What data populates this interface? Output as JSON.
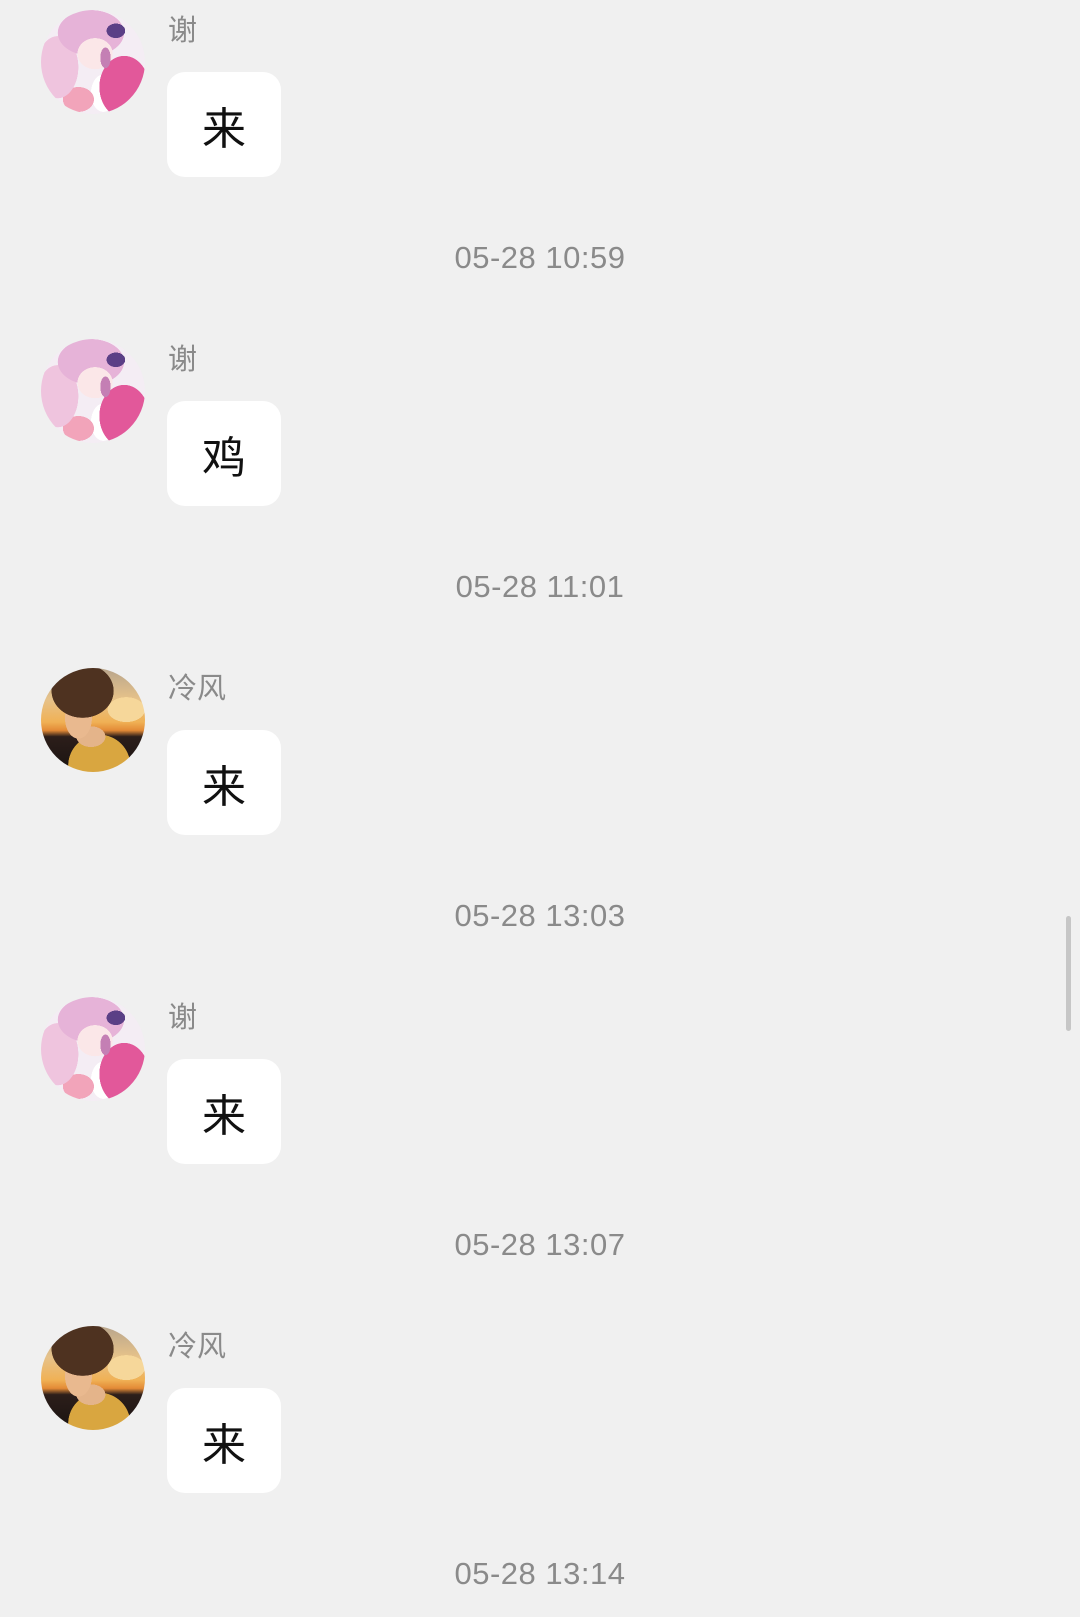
{
  "theme": {
    "background": "#f0f0f0",
    "bubble": "#ffffff",
    "meta_text": "#8a8a8a"
  },
  "timeline": [
    {
      "type": "message",
      "sender": "谢",
      "avatar_icon": "anime-girl-avatar",
      "text": "来"
    },
    {
      "type": "time",
      "text": "05-28 10:59"
    },
    {
      "type": "message",
      "sender": "谢",
      "avatar_icon": "anime-girl-avatar",
      "text": "鸡"
    },
    {
      "type": "time",
      "text": "05-28 11:01"
    },
    {
      "type": "message",
      "sender": "冷风",
      "avatar_icon": "anime-boy-sunset-avatar",
      "text": "来"
    },
    {
      "type": "time",
      "text": "05-28 13:03"
    },
    {
      "type": "message",
      "sender": "谢",
      "avatar_icon": "anime-girl-avatar",
      "text": "来"
    },
    {
      "type": "time",
      "text": "05-28 13:07"
    },
    {
      "type": "message",
      "sender": "冷风",
      "avatar_icon": "anime-boy-sunset-avatar",
      "text": "来"
    },
    {
      "type": "time",
      "text": "05-28 13:14"
    }
  ]
}
